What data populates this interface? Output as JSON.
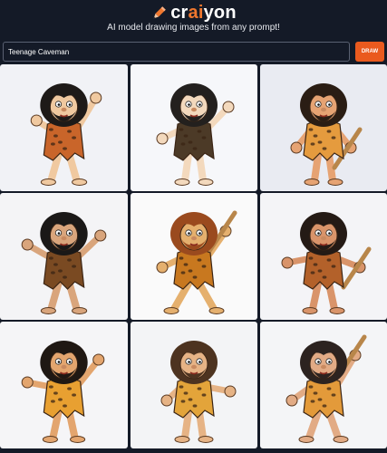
{
  "app": {
    "logo_prefix": "cr",
    "logo_highlight": "ai",
    "logo_suffix": "yon",
    "tagline": "AI model drawing images from any prompt!",
    "accent_color": "#f0772e",
    "logo_icon": "pencil-icon"
  },
  "prompt": {
    "value": "Teenage Caveman",
    "button_label": "DRAW",
    "button_color": "#ea5a1e"
  },
  "results": {
    "images": [
      {
        "name": "result-image-1",
        "bg": "#f1f2f6",
        "hair": "#1e1a18",
        "skin": "#f0c9a0",
        "outfit": "#c9652a"
      },
      {
        "name": "result-image-2",
        "bg": "#f6f7fa",
        "hair": "#23201e",
        "skin": "#f3d9bd",
        "outfit": "#4c3a27"
      },
      {
        "name": "result-image-3",
        "bg": "#e9ebf2",
        "hair": "#2a1d14",
        "skin": "#e6a373",
        "outfit": "#e59b3e"
      },
      {
        "name": "result-image-4",
        "bg": "#f4f4f6",
        "hair": "#1a1817",
        "skin": "#d9a57c",
        "outfit": "#7a4a22"
      },
      {
        "name": "result-image-5",
        "bg": "#fafafa",
        "hair": "#9a4a1e",
        "skin": "#e5b06e",
        "outfit": "#c8781f"
      },
      {
        "name": "result-image-6",
        "bg": "#f4f4f7",
        "hair": "#241a15",
        "skin": "#d9946a",
        "outfit": "#b3612a"
      },
      {
        "name": "result-image-7",
        "bg": "#f5f5f7",
        "hair": "#1f1813",
        "skin": "#e3a56e",
        "outfit": "#e8a031"
      },
      {
        "name": "result-image-8",
        "bg": "#f3f4f6",
        "hair": "#4d3320",
        "skin": "#e6b385",
        "outfit": "#e3a43a"
      },
      {
        "name": "result-image-9",
        "bg": "#f4f5f7",
        "hair": "#2c2320",
        "skin": "#e2ab85",
        "outfit": "#e39a3a"
      }
    ]
  }
}
